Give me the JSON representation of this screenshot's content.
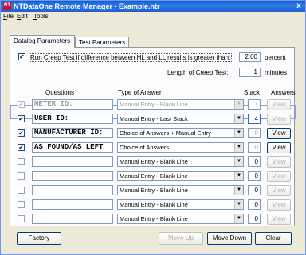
{
  "window": {
    "title": "NTDataOne Remote Manager - Example.ntr",
    "icon_text": "NT",
    "close": "x"
  },
  "menu": [
    {
      "underline": "F",
      "rest": "ile"
    },
    {
      "underline": "E",
      "rest": "dit"
    },
    {
      "underline": "T",
      "rest": "ools"
    }
  ],
  "tabs": [
    {
      "label": "Datalog Parameters",
      "active": true
    },
    {
      "label": "Test Parameters",
      "active": false
    }
  ],
  "creep": {
    "checkbox_mark": "✓",
    "label": "Run Creep Test if difference between HL and LL results is greater than:",
    "threshold": "2.00",
    "threshold_unit": "percent",
    "length_label": "Length of Creep Test:",
    "length": "1",
    "length_unit": "minutes"
  },
  "columns": {
    "questions": "Questions",
    "type": "Type of Answer",
    "stack": "Stack",
    "answers": "Answers"
  },
  "rows": [
    {
      "check": "✓",
      "check_state": "dis",
      "question": "METER ID:",
      "q_state": "dis",
      "type": "Manual Entry - Blank Line",
      "t_state": "dis",
      "stack": "1",
      "s_state": "dis",
      "view": "View",
      "v_state": "dis"
    },
    {
      "check": "✓",
      "check_state": "on",
      "question": "USER ID:",
      "q_state": "on",
      "type": "Manual Entry - Last Stack",
      "t_state": "on",
      "stack": "4",
      "s_state": "on",
      "view": "View",
      "v_state": "dis"
    },
    {
      "check": "✓",
      "check_state": "on",
      "question": "MANUFACTURER ID:",
      "q_state": "on",
      "type": "Choice of Answers + Manual Entry",
      "t_state": "on",
      "stack": "0",
      "s_state": "dis",
      "view": "View",
      "v_state": "on"
    },
    {
      "check": "✓",
      "check_state": "on",
      "question": "AS FOUND/AS LEFT",
      "q_state": "on",
      "type": "Choice of Answers",
      "t_state": "on",
      "stack": "0",
      "s_state": "dis",
      "view": "View",
      "v_state": "on"
    },
    {
      "check": "",
      "check_state": "off",
      "question": "",
      "q_state": "on",
      "type": "Manual Entry - Blank Line",
      "t_state": "on",
      "stack": "0",
      "s_state": "on",
      "view": "View",
      "v_state": "dis"
    },
    {
      "check": "",
      "check_state": "off",
      "question": "",
      "q_state": "on",
      "type": "Manual Entry - Blank Line",
      "t_state": "on",
      "stack": "0",
      "s_state": "on",
      "view": "View",
      "v_state": "dis"
    },
    {
      "check": "",
      "check_state": "off",
      "question": "",
      "q_state": "on",
      "type": "Manual Entry - Blank Line",
      "t_state": "on",
      "stack": "0",
      "s_state": "on",
      "view": "View",
      "v_state": "dis"
    },
    {
      "check": "",
      "check_state": "off",
      "question": "",
      "q_state": "on",
      "type": "Manual Entry - Blank Line",
      "t_state": "on",
      "stack": "0",
      "s_state": "on",
      "view": "View",
      "v_state": "dis"
    },
    {
      "check": "",
      "check_state": "off",
      "question": "",
      "q_state": "on",
      "type": "Manual Entry - Blank Line",
      "t_state": "on",
      "stack": "0",
      "s_state": "on",
      "view": "View",
      "v_state": "dis"
    }
  ],
  "buttons": {
    "factory": "Factory",
    "move_up": "Move Up",
    "move_down": "Move Down",
    "clear": "Clear"
  }
}
